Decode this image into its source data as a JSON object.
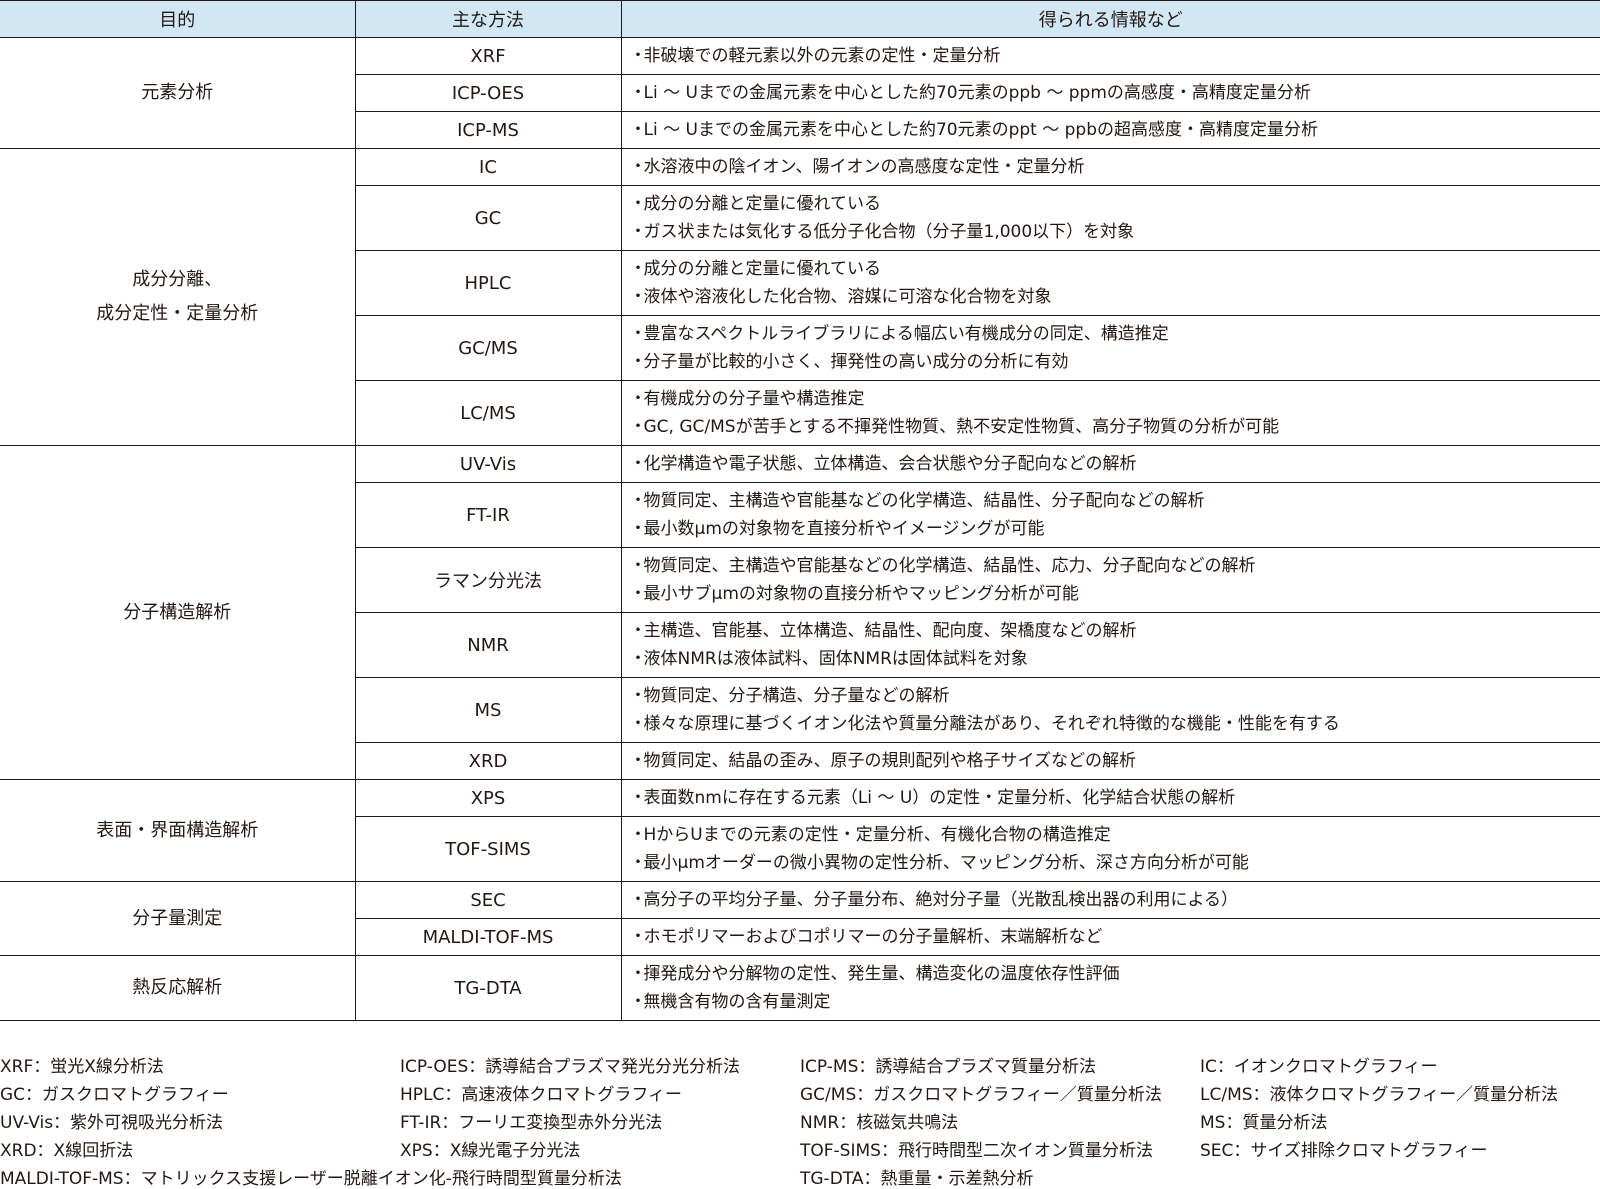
{
  "headers": {
    "purpose": "目的",
    "method": "主な方法",
    "info": "得られる情報など"
  },
  "groups": [
    {
      "purpose": "元素分析",
      "rows": [
        {
          "method": "XRF",
          "info": [
            "非破壊での軽元素以外の元素の定性・定量分析"
          ]
        },
        {
          "method": "ICP-OES",
          "info": [
            "Li ～ Uまでの金属元素を中心とした約70元素のppb ～ ppmの高感度・高精度定量分析"
          ]
        },
        {
          "method": "ICP-MS",
          "info": [
            "Li ～ Uまでの金属元素を中心とした約70元素のppt ～ ppbの超高感度・高精度定量分析"
          ]
        }
      ]
    },
    {
      "purpose": "成分分離、\n成分定性・定量分析",
      "rows": [
        {
          "method": "IC",
          "info": [
            "水溶液中の陰イオン、陽イオンの高感度な定性・定量分析"
          ]
        },
        {
          "method": "GC",
          "info": [
            "成分の分離と定量に優れている",
            "ガス状または気化する低分子化合物（分子量1,000以下）を対象"
          ]
        },
        {
          "method": "HPLC",
          "info": [
            "成分の分離と定量に優れている",
            "液体や溶液化した化合物、溶媒に可溶な化合物を対象"
          ]
        },
        {
          "method": "GC/MS",
          "info": [
            "豊富なスペクトルライブラリによる幅広い有機成分の同定、構造推定",
            "分子量が比較的小さく、揮発性の高い成分の分析に有効"
          ]
        },
        {
          "method": "LC/MS",
          "info": [
            "有機成分の分子量や構造推定",
            "GC, GC/MSが苦手とする不揮発性物質、熱不安定性物質、高分子物質の分析が可能"
          ]
        }
      ]
    },
    {
      "purpose": "分子構造解析",
      "rows": [
        {
          "method": "UV-Vis",
          "info": [
            "化学構造や電子状態、立体構造、会合状態や分子配向などの解析"
          ]
        },
        {
          "method": "FT-IR",
          "info": [
            "物質同定、主構造や官能基などの化学構造、結晶性、分子配向などの解析",
            "最小数μmの対象物を直接分析やイメージングが可能"
          ]
        },
        {
          "method": "ラマン分光法",
          "info": [
            "物質同定、主構造や官能基などの化学構造、結晶性、応力、分子配向などの解析",
            "最小サブμmの対象物の直接分析やマッピング分析が可能"
          ]
        },
        {
          "method": "NMR",
          "info": [
            "主構造、官能基、立体構造、結晶性、配向度、架橋度などの解析",
            "液体NMRは液体試料、固体NMRは固体試料を対象"
          ]
        },
        {
          "method": "MS",
          "info": [
            "物質同定、分子構造、分子量などの解析",
            "様々な原理に基づくイオン化法や質量分離法があり、それぞれ特徴的な機能・性能を有する"
          ]
        },
        {
          "method": "XRD",
          "info": [
            "物質同定、結晶の歪み、原子の規則配列や格子サイズなどの解析"
          ]
        }
      ]
    },
    {
      "purpose": "表面・界面構造解析",
      "rows": [
        {
          "method": "XPS",
          "info": [
            "表面数nmに存在する元素（Li ～ U）の定性・定量分析、化学結合状態の解析"
          ]
        },
        {
          "method": "TOF-SIMS",
          "info": [
            "HからUまでの元素の定性・定量分析、有機化合物の構造推定",
            "最小μmオーダーの微小異物の定性分析、マッピング分析、深さ方向分析が可能"
          ]
        }
      ]
    },
    {
      "purpose": "分子量測定",
      "rows": [
        {
          "method": "SEC",
          "info": [
            "高分子の平均分子量、分子量分布、絶対分子量（光散乱検出器の利用による）"
          ]
        },
        {
          "method": "MALDI-TOF-MS",
          "info": [
            "ホモポリマーおよびコポリマーの分子量解析、末端解析など"
          ]
        }
      ]
    },
    {
      "purpose": "熱反応解析",
      "rows": [
        {
          "method": "TG-DTA",
          "info": [
            "揮発成分や分解物の定性、発生量、構造変化の温度依存性評価",
            "無機含有物の含有量測定"
          ]
        }
      ]
    }
  ],
  "legend": [
    [
      "XRF：蛍光X線分析法",
      "ICP-OES：誘導結合プラズマ発光分光分析法",
      "ICP-MS：誘導結合プラズマ質量分析法",
      "IC：イオンクロマトグラフィー"
    ],
    [
      "GC：ガスクロマトグラフィー",
      "HPLC：高速液体クロマトグラフィー",
      "GC/MS：ガスクロマトグラフィー／質量分析法",
      "LC/MS：液体クロマトグラフィー／質量分析法"
    ],
    [
      "UV-Vis：紫外可視吸光分析法",
      "FT-IR：フーリエ変換型赤外分光法",
      "NMR：核磁気共鳴法",
      "MS：質量分析法"
    ],
    [
      "XRD：X線回折法",
      "XPS：X線光電子分光法",
      "TOF-SIMS：飛行時間型二次イオン質量分析法",
      "SEC：サイズ排除クロマトグラフィー"
    ],
    [
      "MALDI-TOF-MS：マトリックス支援レーザー脱離イオン化-飛行時間型質量分析法",
      "",
      "TG-DTA：熱重量・示差熱分析",
      ""
    ]
  ]
}
